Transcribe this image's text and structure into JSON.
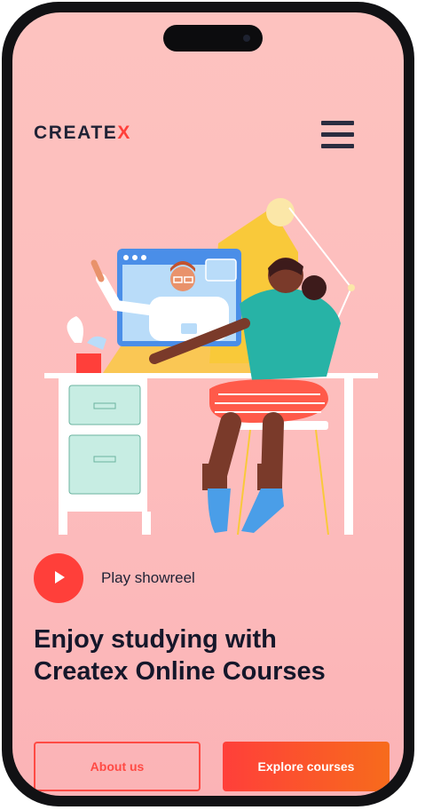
{
  "header": {
    "logo_main": "CREATE",
    "logo_accent": "X",
    "menu_icon": "hamburger-menu-icon"
  },
  "hero": {
    "illustration": "online-video-lesson-illustration",
    "play_icon": "play-icon",
    "play_label": "Play showreel",
    "headline_line1": "Enjoy studying with",
    "headline_line2": "Createx Online Courses"
  },
  "actions": {
    "about_label": "About us",
    "explore_label": "Explore courses"
  },
  "colors": {
    "accent": "#ff3f3a",
    "accent_gradient_end": "#f76b1c",
    "background": "#fdc2bf",
    "text_dark": "#1f2235"
  }
}
